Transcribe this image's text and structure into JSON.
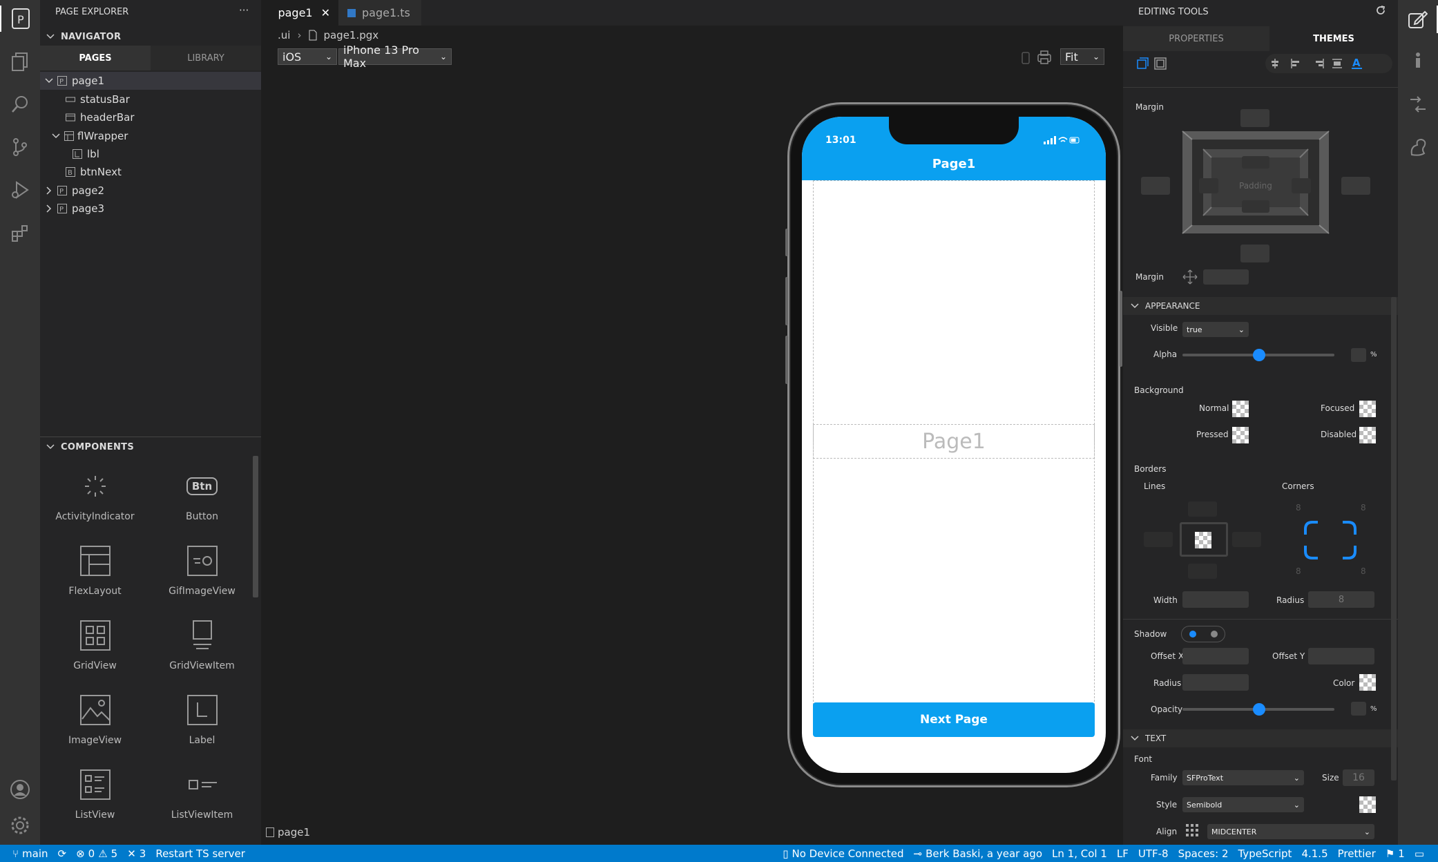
{
  "left_panel": {
    "title": "PAGE EXPLORER",
    "more": "···",
    "navigator": {
      "title": "NAVIGATOR",
      "tabs": [
        {
          "label": "PAGES"
        },
        {
          "label": "LIBRARY"
        }
      ],
      "tree": [
        {
          "label": "page1"
        },
        {
          "label": "statusBar"
        },
        {
          "label": "headerBar"
        },
        {
          "label": "flWrapper"
        },
        {
          "label": "lbl"
        },
        {
          "label": "btnNext"
        },
        {
          "label": "page2"
        },
        {
          "label": "page3"
        }
      ]
    },
    "components": {
      "title": "COMPONENTS",
      "items": [
        {
          "label": "ActivityIndicator"
        },
        {
          "label": "Button",
          "icon_text": "Btn"
        },
        {
          "label": "FlexLayout"
        },
        {
          "label": "GifImageView"
        },
        {
          "label": "GridView"
        },
        {
          "label": "GridViewItem"
        },
        {
          "label": "ImageView"
        },
        {
          "label": "Label"
        },
        {
          "label": "ListView"
        },
        {
          "label": "ListViewItem"
        }
      ]
    }
  },
  "editor": {
    "tabs": [
      {
        "label": "page1"
      },
      {
        "label": "page1.ts"
      }
    ],
    "breadcrumb": {
      "part1": ".ui",
      "part2": "page1.pgx"
    },
    "platform_select": "iOS",
    "device_select": "iPhone 13 Pro Max",
    "zoom_select": "Fit",
    "bottom_label": "page1",
    "phone": {
      "time": "13:01",
      "header_title": "Page1",
      "label_text": "Page1",
      "button_text": "Next Page",
      "accent": "#0aa0f0"
    }
  },
  "right_panel": {
    "title": "EDITING TOOLS",
    "tabs": [
      {
        "label": "PROPERTIES"
      },
      {
        "label": "THEMES"
      }
    ],
    "margin_title": "Margin",
    "padding_label": "Padding",
    "margin_label": "Margin",
    "appearance": {
      "title": "APPEARANCE",
      "visible_label": "Visible",
      "visible_value": "true",
      "alpha_label": "Alpha",
      "alpha_unit": "%",
      "alpha_level": 0.5
    },
    "background": {
      "title": "Background",
      "normal": "Normal",
      "focused": "Focused",
      "pressed": "Pressed",
      "disabled": "Disabled"
    },
    "borders": {
      "title": "Borders",
      "lines": "Lines",
      "corners": "Corners",
      "corner_value": "8",
      "width_label": "Width",
      "radius_label": "Radius",
      "radius_value": "8"
    },
    "shadow": {
      "title": "Shadow",
      "offset_x": "Offset X",
      "offset_y": "Offset Y",
      "radius": "Radius",
      "color": "Color",
      "opacity": "Opacity",
      "opacity_unit": "%",
      "opacity_level": 0.5
    },
    "text": {
      "title": "TEXT",
      "font": "Font",
      "family_label": "Family",
      "family_value": "SFProText",
      "size_label": "Size",
      "size_value": "16",
      "style_label": "Style",
      "style_value": "Semibold",
      "align_label": "Align",
      "align_value": "MIDCENTER"
    }
  },
  "status_bar": {
    "branch": "main",
    "errors": "0",
    "warnings": "5",
    "tools": "3",
    "restart": "Restart TS server",
    "device": "No Device Connected",
    "blame": "Berk Baski, a year ago",
    "position": "Ln 1, Col 1",
    "eol": "LF",
    "encoding": "UTF-8",
    "spaces": "Spaces: 2",
    "language": "TypeScript",
    "version": "4.1.5",
    "prettier": "Prettier",
    "notifications": "1"
  },
  "colors": {
    "accent": "#1a8cff",
    "status": "#007acc"
  }
}
